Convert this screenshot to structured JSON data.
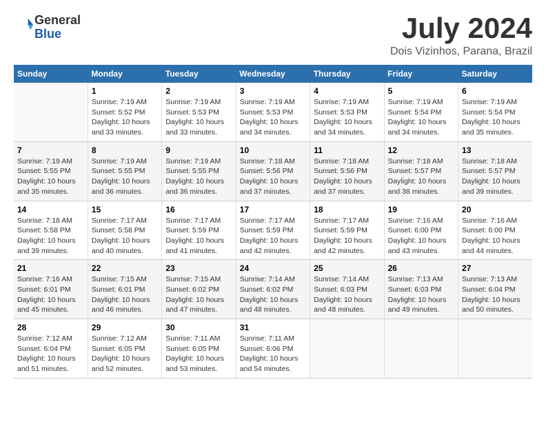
{
  "header": {
    "logo_line1": "General",
    "logo_line2": "Blue",
    "month": "July 2024",
    "location": "Dois Vizinhos, Parana, Brazil"
  },
  "days_of_week": [
    "Sunday",
    "Monday",
    "Tuesday",
    "Wednesday",
    "Thursday",
    "Friday",
    "Saturday"
  ],
  "weeks": [
    [
      {
        "day": "",
        "info": ""
      },
      {
        "day": "1",
        "info": "Sunrise: 7:19 AM\nSunset: 5:52 PM\nDaylight: 10 hours\nand 33 minutes."
      },
      {
        "day": "2",
        "info": "Sunrise: 7:19 AM\nSunset: 5:53 PM\nDaylight: 10 hours\nand 33 minutes."
      },
      {
        "day": "3",
        "info": "Sunrise: 7:19 AM\nSunset: 5:53 PM\nDaylight: 10 hours\nand 34 minutes."
      },
      {
        "day": "4",
        "info": "Sunrise: 7:19 AM\nSunset: 5:53 PM\nDaylight: 10 hours\nand 34 minutes."
      },
      {
        "day": "5",
        "info": "Sunrise: 7:19 AM\nSunset: 5:54 PM\nDaylight: 10 hours\nand 34 minutes."
      },
      {
        "day": "6",
        "info": "Sunrise: 7:19 AM\nSunset: 5:54 PM\nDaylight: 10 hours\nand 35 minutes."
      }
    ],
    [
      {
        "day": "7",
        "info": "Sunrise: 7:19 AM\nSunset: 5:55 PM\nDaylight: 10 hours\nand 35 minutes."
      },
      {
        "day": "8",
        "info": "Sunrise: 7:19 AM\nSunset: 5:55 PM\nDaylight: 10 hours\nand 36 minutes."
      },
      {
        "day": "9",
        "info": "Sunrise: 7:19 AM\nSunset: 5:55 PM\nDaylight: 10 hours\nand 36 minutes."
      },
      {
        "day": "10",
        "info": "Sunrise: 7:18 AM\nSunset: 5:56 PM\nDaylight: 10 hours\nand 37 minutes."
      },
      {
        "day": "11",
        "info": "Sunrise: 7:18 AM\nSunset: 5:56 PM\nDaylight: 10 hours\nand 37 minutes."
      },
      {
        "day": "12",
        "info": "Sunrise: 7:18 AM\nSunset: 5:57 PM\nDaylight: 10 hours\nand 38 minutes."
      },
      {
        "day": "13",
        "info": "Sunrise: 7:18 AM\nSunset: 5:57 PM\nDaylight: 10 hours\nand 39 minutes."
      }
    ],
    [
      {
        "day": "14",
        "info": "Sunrise: 7:18 AM\nSunset: 5:58 PM\nDaylight: 10 hours\nand 39 minutes."
      },
      {
        "day": "15",
        "info": "Sunrise: 7:17 AM\nSunset: 5:58 PM\nDaylight: 10 hours\nand 40 minutes."
      },
      {
        "day": "16",
        "info": "Sunrise: 7:17 AM\nSunset: 5:59 PM\nDaylight: 10 hours\nand 41 minutes."
      },
      {
        "day": "17",
        "info": "Sunrise: 7:17 AM\nSunset: 5:59 PM\nDaylight: 10 hours\nand 42 minutes."
      },
      {
        "day": "18",
        "info": "Sunrise: 7:17 AM\nSunset: 5:59 PM\nDaylight: 10 hours\nand 42 minutes."
      },
      {
        "day": "19",
        "info": "Sunrise: 7:16 AM\nSunset: 6:00 PM\nDaylight: 10 hours\nand 43 minutes."
      },
      {
        "day": "20",
        "info": "Sunrise: 7:16 AM\nSunset: 6:00 PM\nDaylight: 10 hours\nand 44 minutes."
      }
    ],
    [
      {
        "day": "21",
        "info": "Sunrise: 7:16 AM\nSunset: 6:01 PM\nDaylight: 10 hours\nand 45 minutes."
      },
      {
        "day": "22",
        "info": "Sunrise: 7:15 AM\nSunset: 6:01 PM\nDaylight: 10 hours\nand 46 minutes."
      },
      {
        "day": "23",
        "info": "Sunrise: 7:15 AM\nSunset: 6:02 PM\nDaylight: 10 hours\nand 47 minutes."
      },
      {
        "day": "24",
        "info": "Sunrise: 7:14 AM\nSunset: 6:02 PM\nDaylight: 10 hours\nand 48 minutes."
      },
      {
        "day": "25",
        "info": "Sunrise: 7:14 AM\nSunset: 6:03 PM\nDaylight: 10 hours\nand 48 minutes."
      },
      {
        "day": "26",
        "info": "Sunrise: 7:13 AM\nSunset: 6:03 PM\nDaylight: 10 hours\nand 49 minutes."
      },
      {
        "day": "27",
        "info": "Sunrise: 7:13 AM\nSunset: 6:04 PM\nDaylight: 10 hours\nand 50 minutes."
      }
    ],
    [
      {
        "day": "28",
        "info": "Sunrise: 7:12 AM\nSunset: 6:04 PM\nDaylight: 10 hours\nand 51 minutes."
      },
      {
        "day": "29",
        "info": "Sunrise: 7:12 AM\nSunset: 6:05 PM\nDaylight: 10 hours\nand 52 minutes."
      },
      {
        "day": "30",
        "info": "Sunrise: 7:11 AM\nSunset: 6:05 PM\nDaylight: 10 hours\nand 53 minutes."
      },
      {
        "day": "31",
        "info": "Sunrise: 7:11 AM\nSunset: 6:06 PM\nDaylight: 10 hours\nand 54 minutes."
      },
      {
        "day": "",
        "info": ""
      },
      {
        "day": "",
        "info": ""
      },
      {
        "day": "",
        "info": ""
      }
    ]
  ]
}
